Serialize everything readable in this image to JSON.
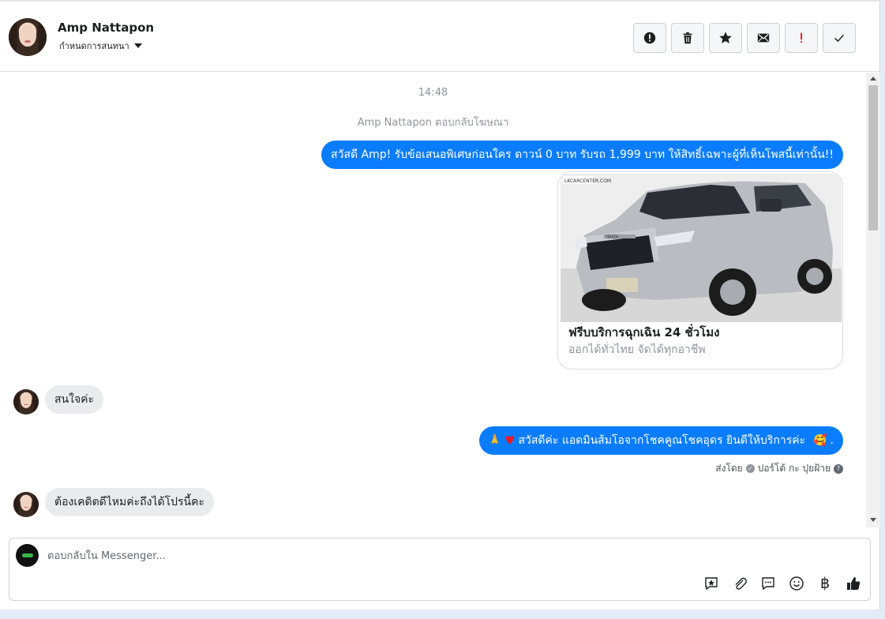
{
  "header": {
    "contact_name": "Amp Nattapon",
    "assign_label": "กำหนดการสนทนา",
    "toolbar": [
      {
        "name": "report-icon",
        "label": "report"
      },
      {
        "name": "trash-icon",
        "label": "delete"
      },
      {
        "name": "star-icon",
        "label": "star"
      },
      {
        "name": "envelope-icon",
        "label": "mark unread"
      },
      {
        "name": "exclamation-icon",
        "label": "important"
      },
      {
        "name": "check-icon",
        "label": "done"
      }
    ]
  },
  "chat": {
    "timestamp": "14:48",
    "ad_reply_notice": "Amp Nattapon ตอบกลับโฆษณา",
    "messages": {
      "greeting": "สวัสดี Amp! รับข้อเสนอพิเศษก่อนใคร ดาวน์ 0 บาท รับรถ 1,999 บาท ให้สิทธิ์เฉพาะผู้ที่เห็นโพสนี้เท่านั้น!!",
      "card_title": "ฟรีบบริการฉุกเฉิน 24 ชั่วโมง",
      "card_subtitle": "ออกได้ทั่วไทย จัดได้ทุกอาชีพ",
      "card_logo_text": "LKCARCENTER.COM",
      "card_car_badge": "ISUZU",
      "customer_1": "สนใจค่ะ",
      "reply_emoji_pray": "🙏",
      "reply_emoji_heart": "♥",
      "reply_text": "สวัสดีค่ะ แอดมินส้มโอจากโชคคูณโชคอุดร ยินดีให้บริการค่ะ",
      "reply_emoji_end": "🥰",
      "reply_end_char": ".",
      "customer_2": "ต้องเคดิตดีไหมค่ะถึงได้โปรนี้คะ"
    },
    "sent_by_prefix": "ส่งโดย",
    "sent_by_name": "ปอร์โต้ กะ ปุยฝ้าย",
    "help_mark": "?"
  },
  "composer": {
    "placeholder": "ตอบกลับใน Messenger...",
    "baht_symbol": "฿"
  },
  "colors": {
    "outgoing_bubble": "#0a7cff",
    "incoming_bubble": "#e9ebee",
    "important_red": "#e41e26"
  }
}
